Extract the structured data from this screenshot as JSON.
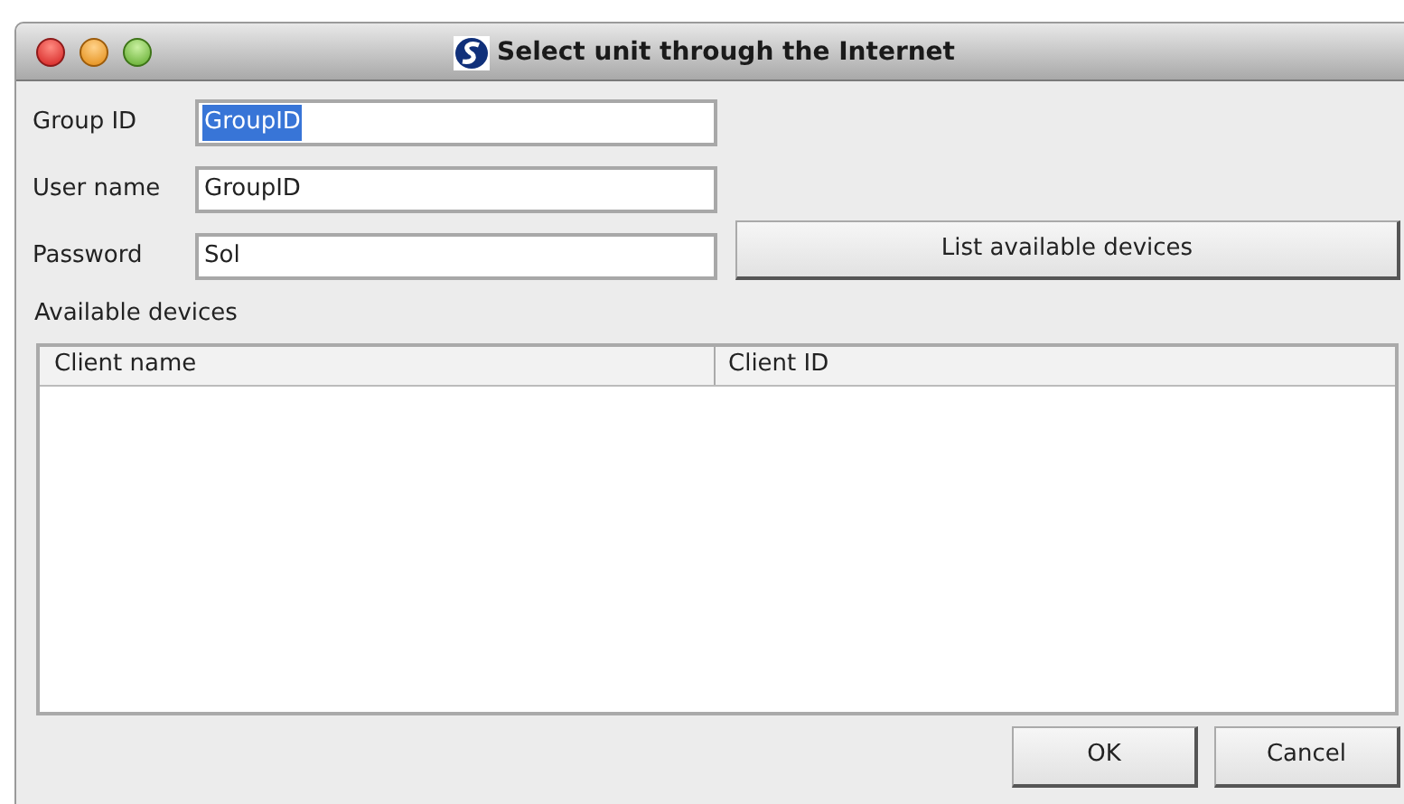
{
  "window": {
    "title": "Select unit through the Internet"
  },
  "fields": [
    {
      "label": "Group ID",
      "value": "GroupID",
      "selected": true
    },
    {
      "label": "User name",
      "value": "GroupID",
      "selected": false
    },
    {
      "label": "Password",
      "value": "Sol",
      "selected": false
    }
  ],
  "list_button": "List available devices",
  "devices": {
    "label": "Available devices",
    "columns": [
      "Client name",
      "Client ID"
    ]
  },
  "buttons": [
    "OK",
    "Cancel"
  ]
}
